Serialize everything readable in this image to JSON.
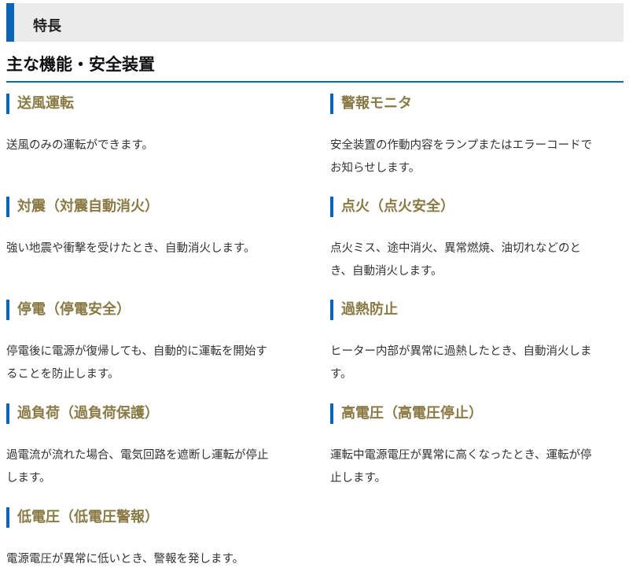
{
  "section_label": "特長",
  "main_heading": "主な機能・安全装置",
  "features": [
    {
      "title": "送風運転",
      "desc_lines": [
        "送風のみの運転ができます。"
      ]
    },
    {
      "title": "警報モニタ",
      "desc_lines": [
        "安全装置の作動内容をランプまたはエラーコードで",
        "お知らせします。"
      ]
    },
    {
      "title": "対震（対震自動消火）",
      "desc_lines": [
        "強い地震や衝撃を受けたとき、自動消火します。"
      ]
    },
    {
      "title": "点火（点火安全）",
      "desc_lines": [
        "点火ミス、途中消火、異常燃焼、油切れなどのと",
        "き、自動消火します。"
      ]
    },
    {
      "title": "停電（停電安全）",
      "desc_lines": [
        "停電後に電源が復帰しても、自動的に運転を開始す",
        "ることを防止します。"
      ]
    },
    {
      "title": "過熱防止",
      "desc_lines": [
        "ヒーター内部が異常に過熱したとき、自動消火しま",
        "す。"
      ]
    },
    {
      "title": "過負荷（過負荷保護）",
      "desc_lines": [
        "過電流が流れた場合、電気回路を遮断し運転が停止",
        "します。"
      ]
    },
    {
      "title": "高電圧（高電圧停止）",
      "desc_lines": [
        "運転中電源電圧が異常に高くなったとき、運転が停",
        "止します。"
      ]
    },
    {
      "title": "低電圧（低電圧警報）",
      "desc_lines": [
        "電源電圧が異常に低いとき、警報を発します。"
      ]
    }
  ],
  "colors": {
    "accent": "#0b64b5",
    "title_text": "#8a7a45",
    "header_bg": "#ebebeb"
  }
}
